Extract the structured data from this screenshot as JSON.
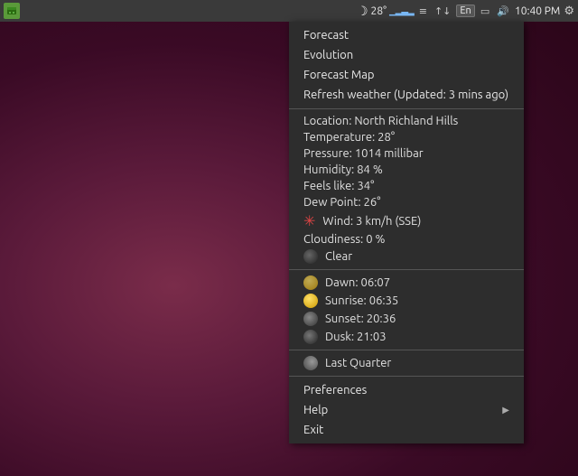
{
  "taskbar": {
    "time": "10:40 PM",
    "temperature": "28°",
    "keyboard_layout": "En"
  },
  "menu": {
    "items": [
      {
        "id": "forecast",
        "label": "Forecast",
        "type": "clickable",
        "icon": null
      },
      {
        "id": "evolution",
        "label": "Evolution",
        "type": "clickable",
        "icon": null
      },
      {
        "id": "forecast-map",
        "label": "Forecast Map",
        "type": "clickable",
        "icon": null
      },
      {
        "id": "refresh",
        "label": "Refresh weather (Updated: 3 mins ago)",
        "type": "clickable",
        "icon": null
      }
    ],
    "info": {
      "location": "Location: North Richland Hills",
      "temperature": "Temperature: 28°",
      "pressure": "Pressure: 1014 millibar",
      "humidity": "Humidity: 84 %",
      "feels_like": "Feels like: 34°",
      "dew_point": "Dew Point: 26°",
      "wind": "Wind: 3 km/h (SSE)",
      "cloudiness": "Cloudiness: 0 %",
      "condition": "Clear",
      "dawn": "Dawn: 06:07",
      "sunrise": "Sunrise: 06:35",
      "sunset": "Sunset: 20:36",
      "dusk": "Dusk: 21:03",
      "moon_phase": "Last Quarter"
    },
    "footer": [
      {
        "id": "preferences",
        "label": "Preferences",
        "type": "clickable",
        "icon": null
      },
      {
        "id": "help",
        "label": "Help",
        "type": "clickable",
        "has_arrow": true
      },
      {
        "id": "exit",
        "label": "Exit",
        "type": "clickable",
        "icon": null
      }
    ]
  }
}
